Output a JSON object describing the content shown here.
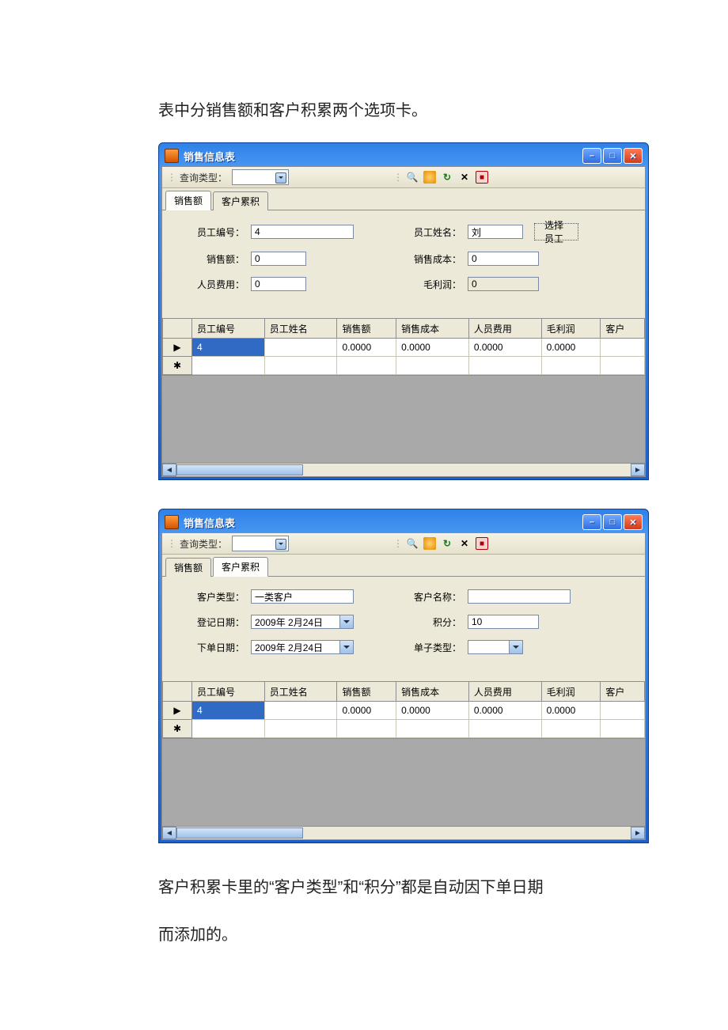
{
  "doc": {
    "intro": "表中分销售额和客户积累两个选项卡。",
    "outro1": "客户积累卡里的“客户类型”和“积分”都是自动因下单日期",
    "outro2": "而添加的。"
  },
  "window1": {
    "title": "销售信息表",
    "toolbar": {
      "query_type_label": "查询类型："
    },
    "tabs": {
      "sales": "销售额",
      "customer": "客户累积"
    },
    "activeTab": "sales",
    "form": {
      "employee_id_label": "员工编号：",
      "employee_id_value": "4",
      "employee_name_label": "员工姓名：",
      "employee_name_value": "刘",
      "select_employee_button": "选择员工",
      "sales_label": "销售额：",
      "sales_value": "0",
      "sales_cost_label": "销售成本：",
      "sales_cost_value": "0",
      "person_fee_label": "人员费用：",
      "person_fee_value": "0",
      "gross_label": "毛利润：",
      "gross_value": "0"
    },
    "grid": {
      "headers": {
        "emp_id": "员工编号",
        "emp_name": "员工姓名",
        "sales": "销售额",
        "cost": "销售成本",
        "fee": "人员费用",
        "gross": "毛利润",
        "cust": "客户"
      },
      "row": {
        "emp_id": "4",
        "emp_name": "",
        "sales": "0.0000",
        "cost": "0.0000",
        "fee": "0.0000",
        "gross": "0.0000",
        "cust": ""
      }
    }
  },
  "window2": {
    "title": "销售信息表",
    "toolbar": {
      "query_type_label": "查询类型："
    },
    "tabs": {
      "sales": "销售额",
      "customer": "客户累积"
    },
    "activeTab": "customer",
    "form": {
      "cust_type_label": "客户类型：",
      "cust_type_value": "一类客户",
      "cust_name_label": "客户名称：",
      "cust_name_value": "",
      "reg_date_label": "登记日期：",
      "reg_date_value": "2009年 2月24日",
      "points_label": "积分：",
      "points_value": "10",
      "order_date_label": "下单日期：",
      "order_date_value": "2009年 2月24日",
      "order_type_label": "单子类型：",
      "order_type_value": ""
    },
    "grid": {
      "headers": {
        "emp_id": "员工编号",
        "emp_name": "员工姓名",
        "sales": "销售额",
        "cost": "销售成本",
        "fee": "人员费用",
        "gross": "毛利润",
        "cust": "客户"
      },
      "row": {
        "emp_id": "4",
        "emp_name": "",
        "sales": "0.0000",
        "cost": "0.0000",
        "fee": "0.0000",
        "gross": "0.0000",
        "cust": ""
      }
    }
  }
}
